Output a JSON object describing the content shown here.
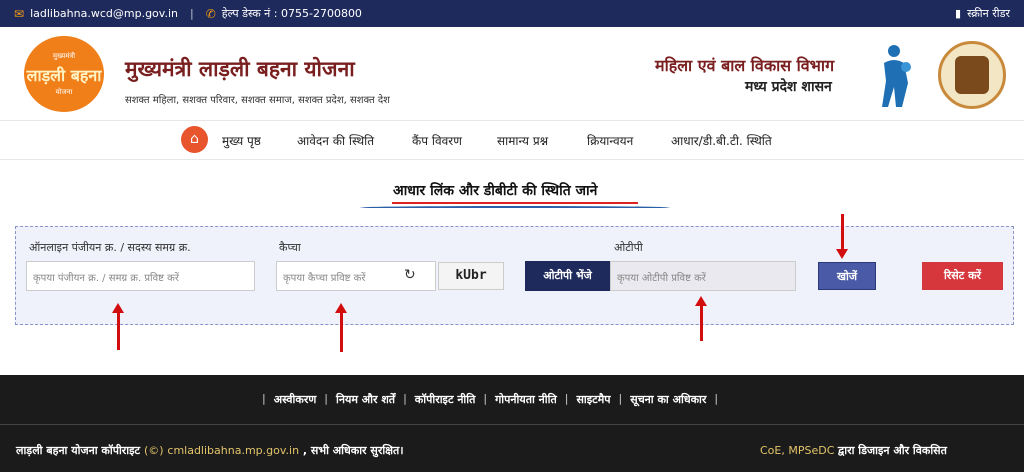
{
  "topbar": {
    "email": "ladlibahna.wcd@mp.gov.in",
    "helpdesk": "हेल्प डेस्क नं : 0755-2700800",
    "screen_reader": "स्क्रीन रीडर"
  },
  "header": {
    "logo_line1": "मुख्यमंत्री",
    "logo_line2": "लाड़ली बहना",
    "logo_line3": "योजना",
    "title": "मुख्यमंत्री लाड़ली बहना योजना",
    "subtitle": "सशक्त महिला, सशक्त परिवार, सशक्त समाज, सशक्त प्रदेश, सशक्त देश",
    "dept_line1": "महिला एवं बाल विकास विभाग",
    "dept_line2": "मध्य प्रदेश शासन"
  },
  "nav": {
    "items": [
      "मुख्य पृष्ठ",
      "आवेदन की स्थिति",
      "कैंप विवरण",
      "सामान्य प्रश्न",
      "क्रियान्वयन",
      "आधार/डी.बी.टी. स्थिति"
    ]
  },
  "form": {
    "section_title": "आधार लिंक और डीबीटी की स्थिति जाने",
    "reg_label": "ऑनलाइन पंजीयन क्र. / सदस्य समग्र क्र.",
    "reg_placeholder": "कृपया पंजीयन क्र. / समग्र क्र. प्रविष्ट करें",
    "captcha_label": "कैप्चा",
    "captcha_placeholder": "कृपया कैप्चा प्रविष्ट करें",
    "captcha_code": "kUbr",
    "otp_label": "ओटीपी",
    "otp_button": "ओटीपी भेंजे",
    "otp_placeholder": "कृपया ओटीपी प्रविष्ट करें",
    "search_button": "खोजें",
    "reset_button": "रिसेट करें"
  },
  "footer": {
    "links": [
      "अस्वीकरण",
      "नियम और शर्तें",
      "कॉपीराइट नीति",
      "गोपनीयता नीति",
      "साइटमैप",
      "सूचना का अधिकार"
    ],
    "copyright_prefix": "लाड़ली बहना योजना कॉपीराइट",
    "copyright_symbol": "(©)",
    "copyright_site": "cmladlibahna.mp.gov.in",
    "copyright_suffix": ", सभी अधिकार सुरक्षित।",
    "credit_org": "CoE, MPSeDC",
    "credit_text": "द्वारा डिजाइन और विकसित"
  },
  "colors": {
    "topbar": "#1f2a5c",
    "accent_orange": "#e8542b",
    "title_maroon": "#7a1f1f",
    "search_btn": "#4b5aa6",
    "reset_btn": "#d6373d",
    "annotation_arrow": "#d20d0d"
  },
  "icons": [
    "mail-icon",
    "phone-icon",
    "book-icon",
    "home-icon",
    "refresh-icon"
  ]
}
